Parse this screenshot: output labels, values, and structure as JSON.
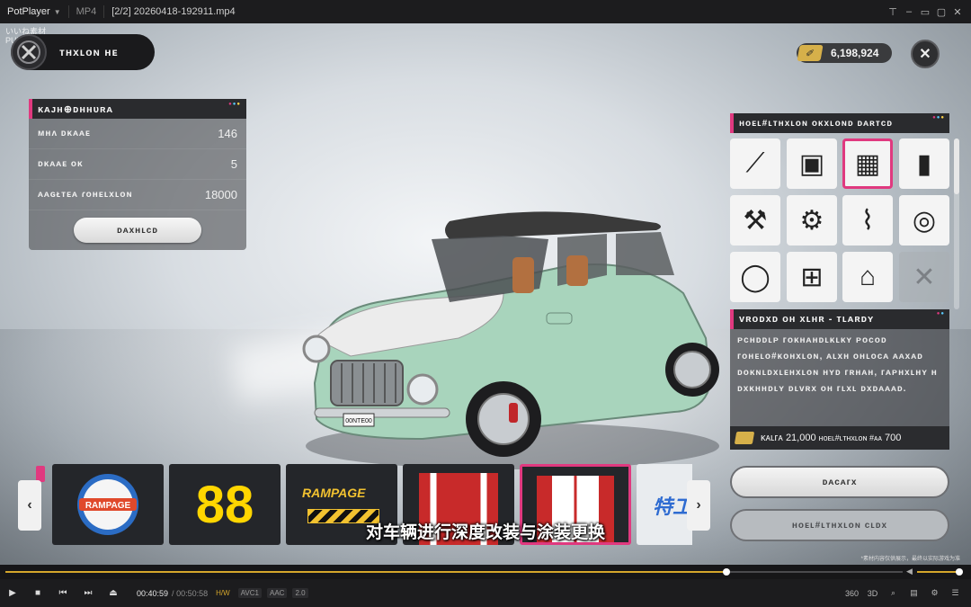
{
  "titlebar": {
    "app_name": "PotPlayer",
    "format": "MP4",
    "filename": "[2/2] 20260418-192911.mp4",
    "buttons": [
      "pin",
      "minimize",
      "restore",
      "maximize",
      "close"
    ]
  },
  "watermark": {
    "line1": "いいね素材",
    "line2": "PUBG正版"
  },
  "game": {
    "player_name": "ᴛʜxʟᴏɴ ʜᴇ",
    "currency_value": "6,198,924",
    "stats": {
      "header": "ᴋᴀᴊʜ⊕ᴅʜʜᴜʀᴀ",
      "rows": [
        {
          "label": "ᴍʜʌ ᴅᴋᴀᴀᴇ",
          "value": "146"
        },
        {
          "label": "ᴅᴋᴀᴀᴇ ᴏᴋ",
          "value": "5"
        },
        {
          "label": "ᴀᴀɢᴌᴛᴇᴀ ɾᴏʜᴇʟxʟᴏɴ",
          "value": "18000"
        }
      ],
      "details_button": "ᴅᴀxʜʟᴄᴅ"
    },
    "customization": {
      "header": "ʜᴏᴇʟ#ʟᴛʜxʟᴏɴ ᴏᴋxʟᴏɴᴅ ᴅᴀʀᴛᴄᴅ",
      "tiles": [
        {
          "icon": "spoiler-icon",
          "glyph": "⟋"
        },
        {
          "icon": "case-icon",
          "glyph": "▣"
        },
        {
          "icon": "checkered-flag-icon",
          "glyph": "▦",
          "selected": true
        },
        {
          "icon": "spray-can-icon",
          "glyph": "▮"
        },
        {
          "icon": "piston-icon",
          "glyph": "⚒"
        },
        {
          "icon": "gear-cog-icon",
          "glyph": "⚙"
        },
        {
          "icon": "suspension-spring-icon",
          "glyph": "⌇"
        },
        {
          "icon": "brake-disc-icon",
          "glyph": "◎"
        },
        {
          "icon": "tire-icon",
          "glyph": "◯"
        },
        {
          "icon": "engine-icon",
          "glyph": "⊞"
        },
        {
          "icon": "car-frame-icon",
          "glyph": "⌂"
        },
        {
          "icon": "locked-slot-icon",
          "glyph": "✕",
          "empty": true
        }
      ],
      "description": {
        "header": "ᴠʀᴏᴅxᴅ ᴏʜ xʟʜʀ - ᴛʟᴀʀᴅʏ",
        "text": "ᴘᴄʜᴅᴅʟᴘ ᴦᴏᴋʜᴀʜᴅʟᴋʟᴋʏ ᴘᴏᴄᴏᴅ ᴦᴏʜᴇʟᴏ#ᴋᴏʜxʟᴏɴ, ᴀʟxʜ ᴏʜʟᴏᴄᴀ ᴀᴀxᴀᴅ ᴅᴏᴋɴʟᴅxʟᴇʜxʟᴏɴ ʜʏᴅ ᴦʀʜᴀʜ, ᴦᴀᴘʜxʟʜʏ ʜ ᴅxᴋʜʜᴅʟʏ ᴅʟᴠʀx ᴏʜ ᴦʟxʟ ᴅxᴅᴀᴀᴀᴅ.",
        "cost_prefix": "ᴋᴀʟᴦᴀ",
        "cost_amount": "21,000",
        "cost_suffix_label": "ʜᴏᴇʟ#ʟᴛʜxʟᴏɴ #ᴀᴀ",
        "cost_suffix_value": "700"
      },
      "purchase_button": "ᴅᴀᴄᴀᴦx",
      "apply_button": "ʜᴏᴇʟ#ʟᴛʜxʟᴏɴ ᴄʟᴅx"
    },
    "decals": [
      {
        "name": "decal-rampage-logo",
        "text": "RAMPAGE"
      },
      {
        "name": "decal-number-88",
        "text": "88"
      },
      {
        "name": "decal-rampage-forward",
        "text": "RAMPAGE"
      },
      {
        "name": "decal-stripes-a",
        "text": ""
      },
      {
        "name": "decal-stripes-b",
        "text": "",
        "selected": true
      },
      {
        "name": "decal-special",
        "text": "特工"
      }
    ],
    "subtitle": "对车辆进行深度改装与涂装更换",
    "disclaimer": "*素材内容仅供展示，最终以实际游戏为准",
    "license_plate": "00NTE00"
  },
  "player": {
    "current_time": "00:40:59",
    "duration": "00:50:58",
    "hw": "H/W",
    "codec_video": "AVC1",
    "codec_audio": "AAC",
    "channels": "2.0",
    "progress": 0.804,
    "volume": 0.9,
    "right_controls": [
      "360",
      "3D",
      "zoom",
      "subtitles",
      "settings",
      "menu"
    ]
  },
  "colors": {
    "accent": "#e0397f",
    "player_accent": "#d4a62b",
    "currency": "#d6b04a"
  }
}
